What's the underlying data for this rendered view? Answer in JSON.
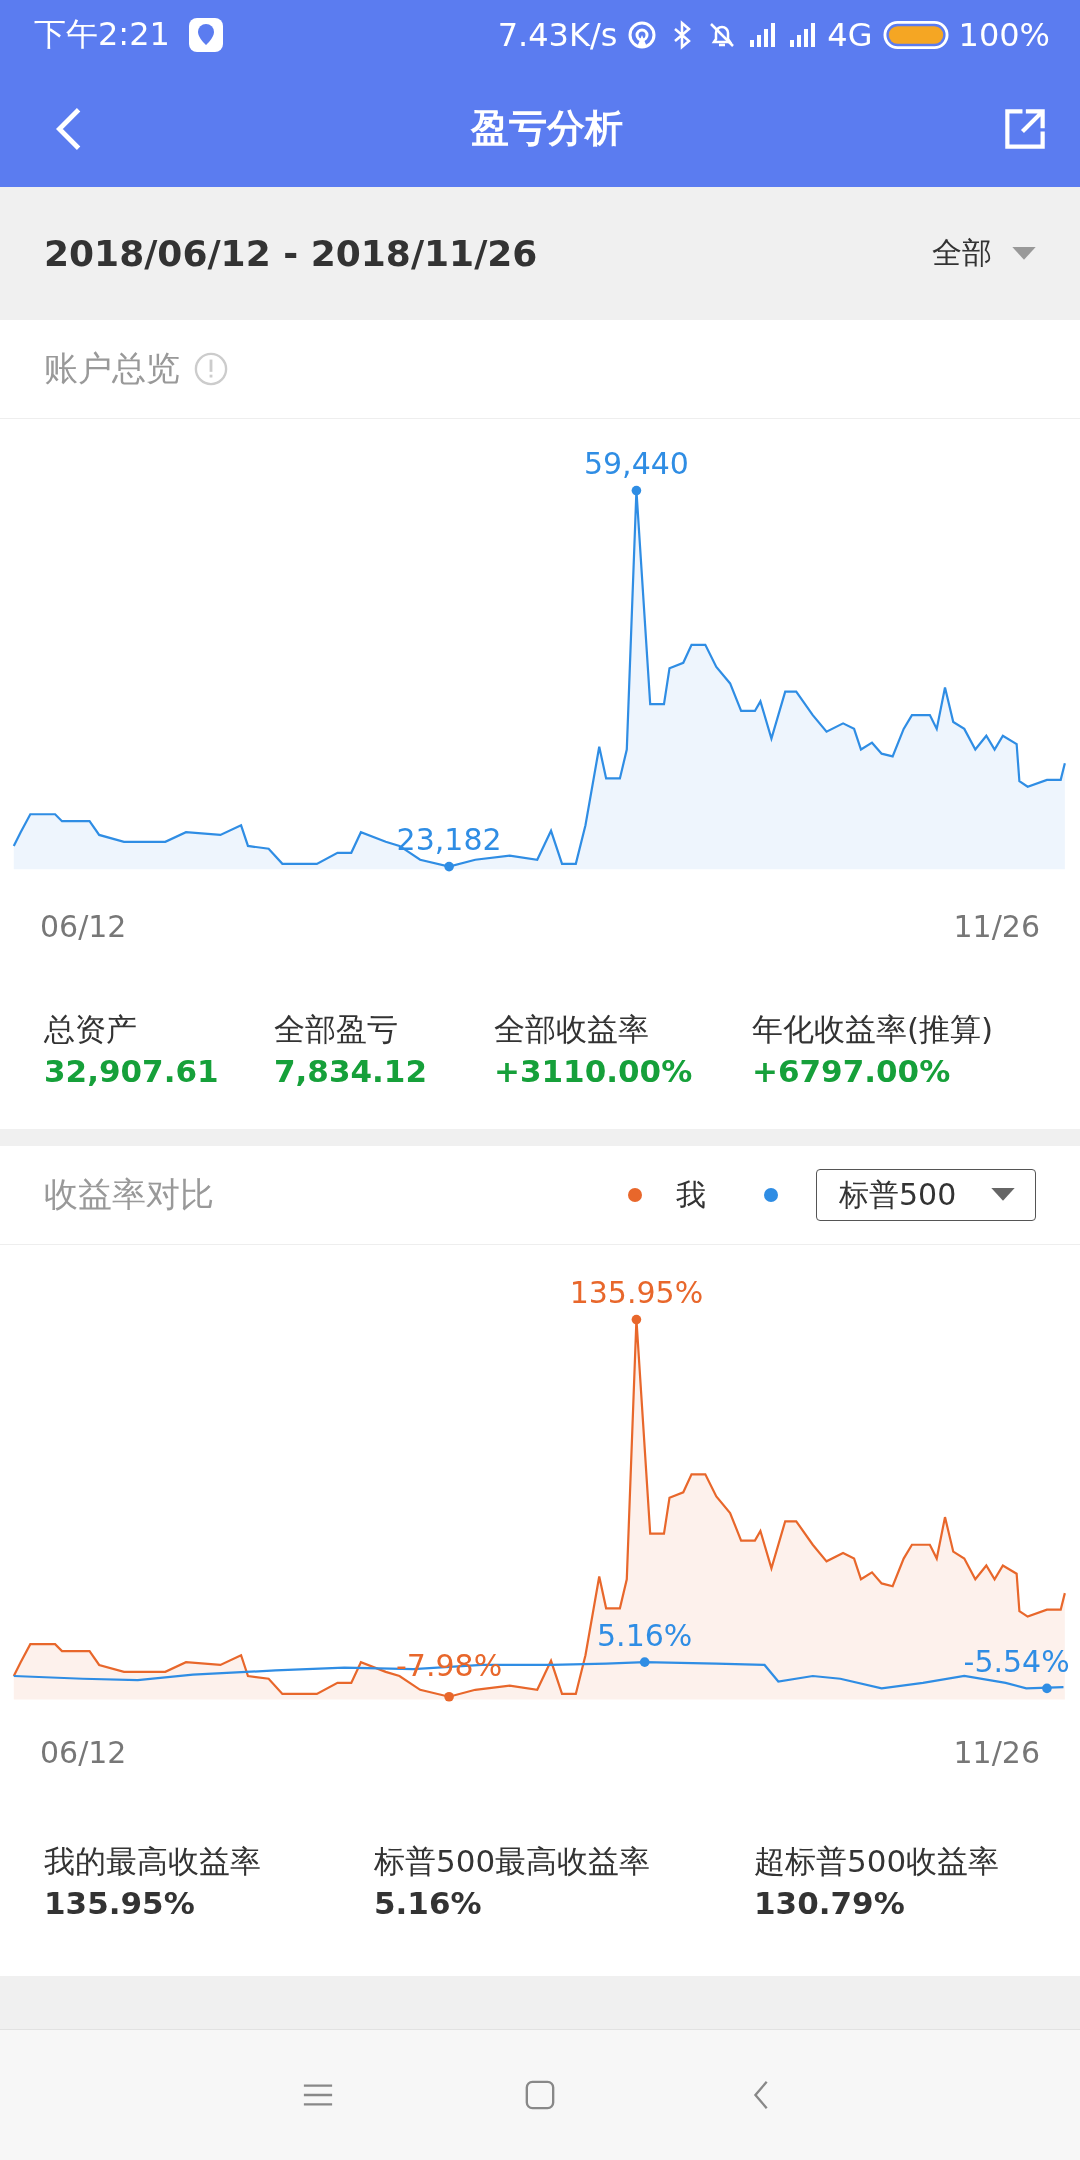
{
  "status_bar": {
    "time": "下午2:21",
    "speed": "7.43K/s",
    "network": "4G",
    "battery": "100%"
  },
  "header": {
    "title": "盈亏分析"
  },
  "date_bar": {
    "range": "2018/06/12 - 2018/11/26",
    "filter": "全部"
  },
  "overview": {
    "title": "账户总览",
    "annotations": [
      "59,440",
      "23,182"
    ],
    "x_start": "06/12",
    "x_end": "11/26",
    "stats": [
      {
        "label": "总资产",
        "value": "32,907.61"
      },
      {
        "label": "全部盈亏",
        "value": "7,834.12"
      },
      {
        "label": "全部收益率",
        "value": "+3110.00%"
      },
      {
        "label": "年化收益率(推算)",
        "value": "+6797.00%"
      }
    ]
  },
  "comparison": {
    "title": "收益率对比",
    "me": {
      "label": "我",
      "color": "#e8672b"
    },
    "benchmark": {
      "value": "标普500",
      "color": "#2f8de4"
    },
    "annotations": [
      {
        "text": "135.95%",
        "kind": "me"
      },
      {
        "text": "-7.98%",
        "kind": "me"
      },
      {
        "text": "5.16%",
        "kind": "benchmark"
      },
      {
        "text": "-5.54%",
        "kind": "benchmark"
      }
    ],
    "x_start": "06/12",
    "x_end": "11/26",
    "stats": [
      {
        "label": "我的最高收益率",
        "value": "135.95%"
      },
      {
        "label": "标普500最高收益率",
        "value": "5.16%"
      },
      {
        "label": "超标普500收益率",
        "value": "130.79%"
      }
    ]
  }
}
